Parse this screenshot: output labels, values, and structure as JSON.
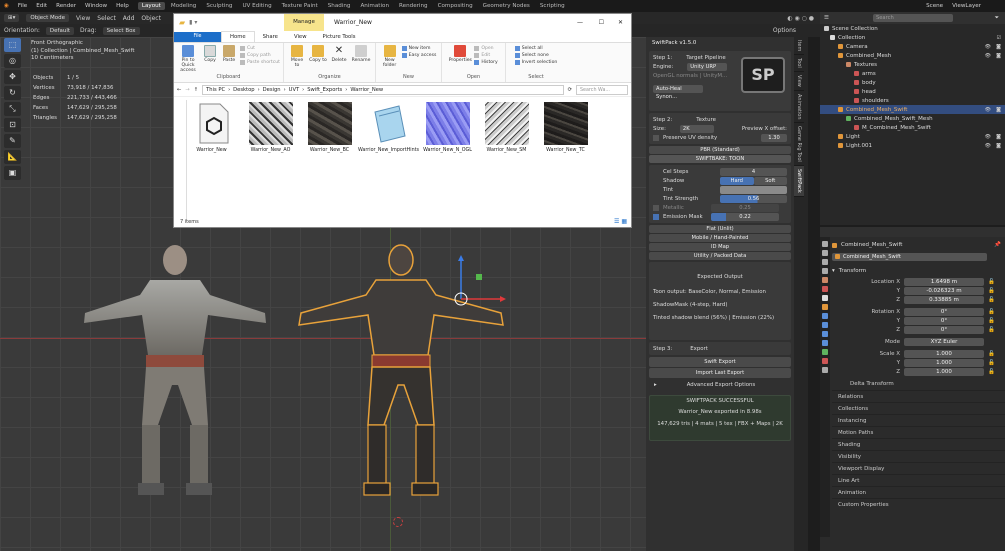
{
  "topbar": {
    "menus": [
      "File",
      "Edit",
      "Render",
      "Window",
      "Help"
    ],
    "workspaces": [
      "Layout",
      "Modeling",
      "Sculpting",
      "UV Editing",
      "Texture Paint",
      "Shading",
      "Animation",
      "Rendering",
      "Compositing",
      "Geometry Nodes",
      "Scripting"
    ],
    "active_workspace": "Layout",
    "scene": "Scene",
    "view_layer": "ViewLayer"
  },
  "header": {
    "mode": "Object Mode",
    "menus": [
      "View",
      "Select",
      "Add",
      "Object"
    ],
    "orientation_label": "Orientation:",
    "orientation_value": "Default",
    "drag_label": "Drag:",
    "drag_value": "Select Box",
    "options": "Options"
  },
  "viewport_info": {
    "view": "Front Orthographic",
    "collection": "(1) Collection | Combined_Mesh_Swift",
    "scale": "10 Centimeters",
    "stats": [
      {
        "label": "Objects",
        "value": "1 / 5"
      },
      {
        "label": "Vertices",
        "value": "73,918 / 147,836"
      },
      {
        "label": "Edges",
        "value": "221,733 / 443,466"
      },
      {
        "label": "Faces",
        "value": "147,629 / 295,258"
      },
      {
        "label": "Triangles",
        "value": "147,629 / 295,258"
      }
    ]
  },
  "explorer": {
    "title": "Warrior_New",
    "manage_tab": "Manage",
    "tabs": [
      "File",
      "Home",
      "Share",
      "View",
      "Picture Tools"
    ],
    "clipboard": {
      "pin": "Pin to Quick access",
      "copy": "Copy",
      "paste": "Paste",
      "cut": "Cut",
      "copy_path": "Copy path",
      "paste_shortcut": "Paste shortcut",
      "label": "Clipboard"
    },
    "organize": {
      "move_to": "Move to",
      "copy_to": "Copy to",
      "delete": "Delete",
      "rename": "Rename",
      "label": "Organize"
    },
    "new": {
      "new_folder": "New folder",
      "new_item": "New item",
      "easy_access": "Easy access",
      "label": "New"
    },
    "open": {
      "properties": "Properties",
      "open": "Open",
      "edit": "Edit",
      "history": "History",
      "label": "Open"
    },
    "select": {
      "select_all": "Select all",
      "select_none": "Select none",
      "invert": "Invert selection",
      "label": "Select"
    },
    "path": [
      "This PC",
      "Desktop",
      "Design",
      "UVT",
      "Swift_Exports",
      "Warrior_New"
    ],
    "search_placeholder": "Search Wa...",
    "files": [
      "Warrior_New",
      "Warrior_New_AO",
      "Warrior_New_BC",
      "Warrior_New_ImportHints",
      "Warrior_New_N_OGL",
      "Warrior_New_SM",
      "Warrior_New_TC"
    ],
    "item_count": "7 items"
  },
  "swiftpack": {
    "title": "SwiftPack v1.5.0",
    "step1": "Step 1:",
    "step1_title": "Target Pipeline",
    "engine_label": "Engine:",
    "engine_value": "Unity URP",
    "hint": "OpenGL normals | UnityM...",
    "auto_heal": "Auto-Heal Synon...",
    "logo": "SP",
    "step2": "Step 2:",
    "step2_title": "Texture",
    "size_label": "Size:",
    "size_value": "2K",
    "preview_label": "Preview X offset:",
    "preview_value": "1.30",
    "preserve_uv": "Preserve UV density",
    "pbr": "PBR (Standard)",
    "swiftbake": "SWIFTBAKE: TOON",
    "cel_steps_label": "Cel Steps",
    "cel_steps_value": "4",
    "shadow_label": "Shadow",
    "shadow_hard": "Hard",
    "shadow_soft": "Soft",
    "tint_label": "Tint",
    "tint_strength_label": "Tint Strength",
    "tint_strength_value": "0.56",
    "metallic_label": "Metallic",
    "metallic_value": "0.25",
    "emission_mask_label": "Emission Mask",
    "emission_mask_value": "0.22",
    "flat": "Flat (Unlit)",
    "mobile": "Mobile / Hand-Painted",
    "id_map": "ID Map",
    "utility": "Utility / Packed Data",
    "expected_title": "Expected Output",
    "expected_lines": [
      "Toon output: BaseColor, Normal, Emission",
      "ShadowMask (4-step, Hard)",
      "Tinted shadow blend (56%) | Emission (22%)"
    ],
    "step3": "Step 3:",
    "step3_title": "Export",
    "swift_export": "Swift Export",
    "import_last": "Import Last Export",
    "advanced": "Advanced Export Options",
    "success": "SWIFTPACK SUCCESSFUL",
    "exported": "Warrior_New exported in 8.98s",
    "summary": "147,629 tris | 4 mats | 5 tex | FBX + Maps | 2K"
  },
  "side_tabs": [
    "Item",
    "Tool",
    "View",
    "Animation",
    "Game Rig Tool",
    "SwiftPack"
  ],
  "outliner": {
    "search_placeholder": "Search",
    "rows": [
      {
        "label": "Scene Collection",
        "indent": 0
      },
      {
        "label": "Collection",
        "indent": 1
      },
      {
        "label": "Camera",
        "indent": 2
      },
      {
        "label": "Combined_Mesh",
        "indent": 2
      },
      {
        "label": "Textures",
        "indent": 3
      },
      {
        "label": "arms",
        "indent": 4
      },
      {
        "label": "body",
        "indent": 4
      },
      {
        "label": "head",
        "indent": 4
      },
      {
        "label": "shoulders",
        "indent": 4
      },
      {
        "label": "Combined_Mesh_Swift",
        "indent": 2
      },
      {
        "label": "Combined_Mesh_Swift_Mesh",
        "indent": 3
      },
      {
        "label": "M_Combined_Mesh_Swift",
        "indent": 4
      },
      {
        "label": "Light",
        "indent": 2
      },
      {
        "label": "Light.001",
        "indent": 2
      }
    ]
  },
  "properties": {
    "object_name": "Combined_Mesh_Swift",
    "object_field": "Combined_Mesh_Swift",
    "transform": "Transform",
    "location_label": "Location X",
    "location": [
      "1.6498 m",
      "-0.026323 m",
      "0.33885 m"
    ],
    "rotation_label": "Rotation X",
    "rotation": [
      "0°",
      "0°",
      "0°"
    ],
    "mode_label": "Mode",
    "mode_value": "XYZ Euler",
    "scale_label": "Scale X",
    "scale": [
      "1.000",
      "1.000",
      "1.000"
    ],
    "y_label": "Y",
    "z_label": "Z",
    "delta": "Delta Transform",
    "sections": [
      "Relations",
      "Collections",
      "Instancing",
      "Motion Paths",
      "Shading",
      "Visibility",
      "Viewport Display",
      "Line Art",
      "Animation",
      "Custom Properties"
    ]
  }
}
